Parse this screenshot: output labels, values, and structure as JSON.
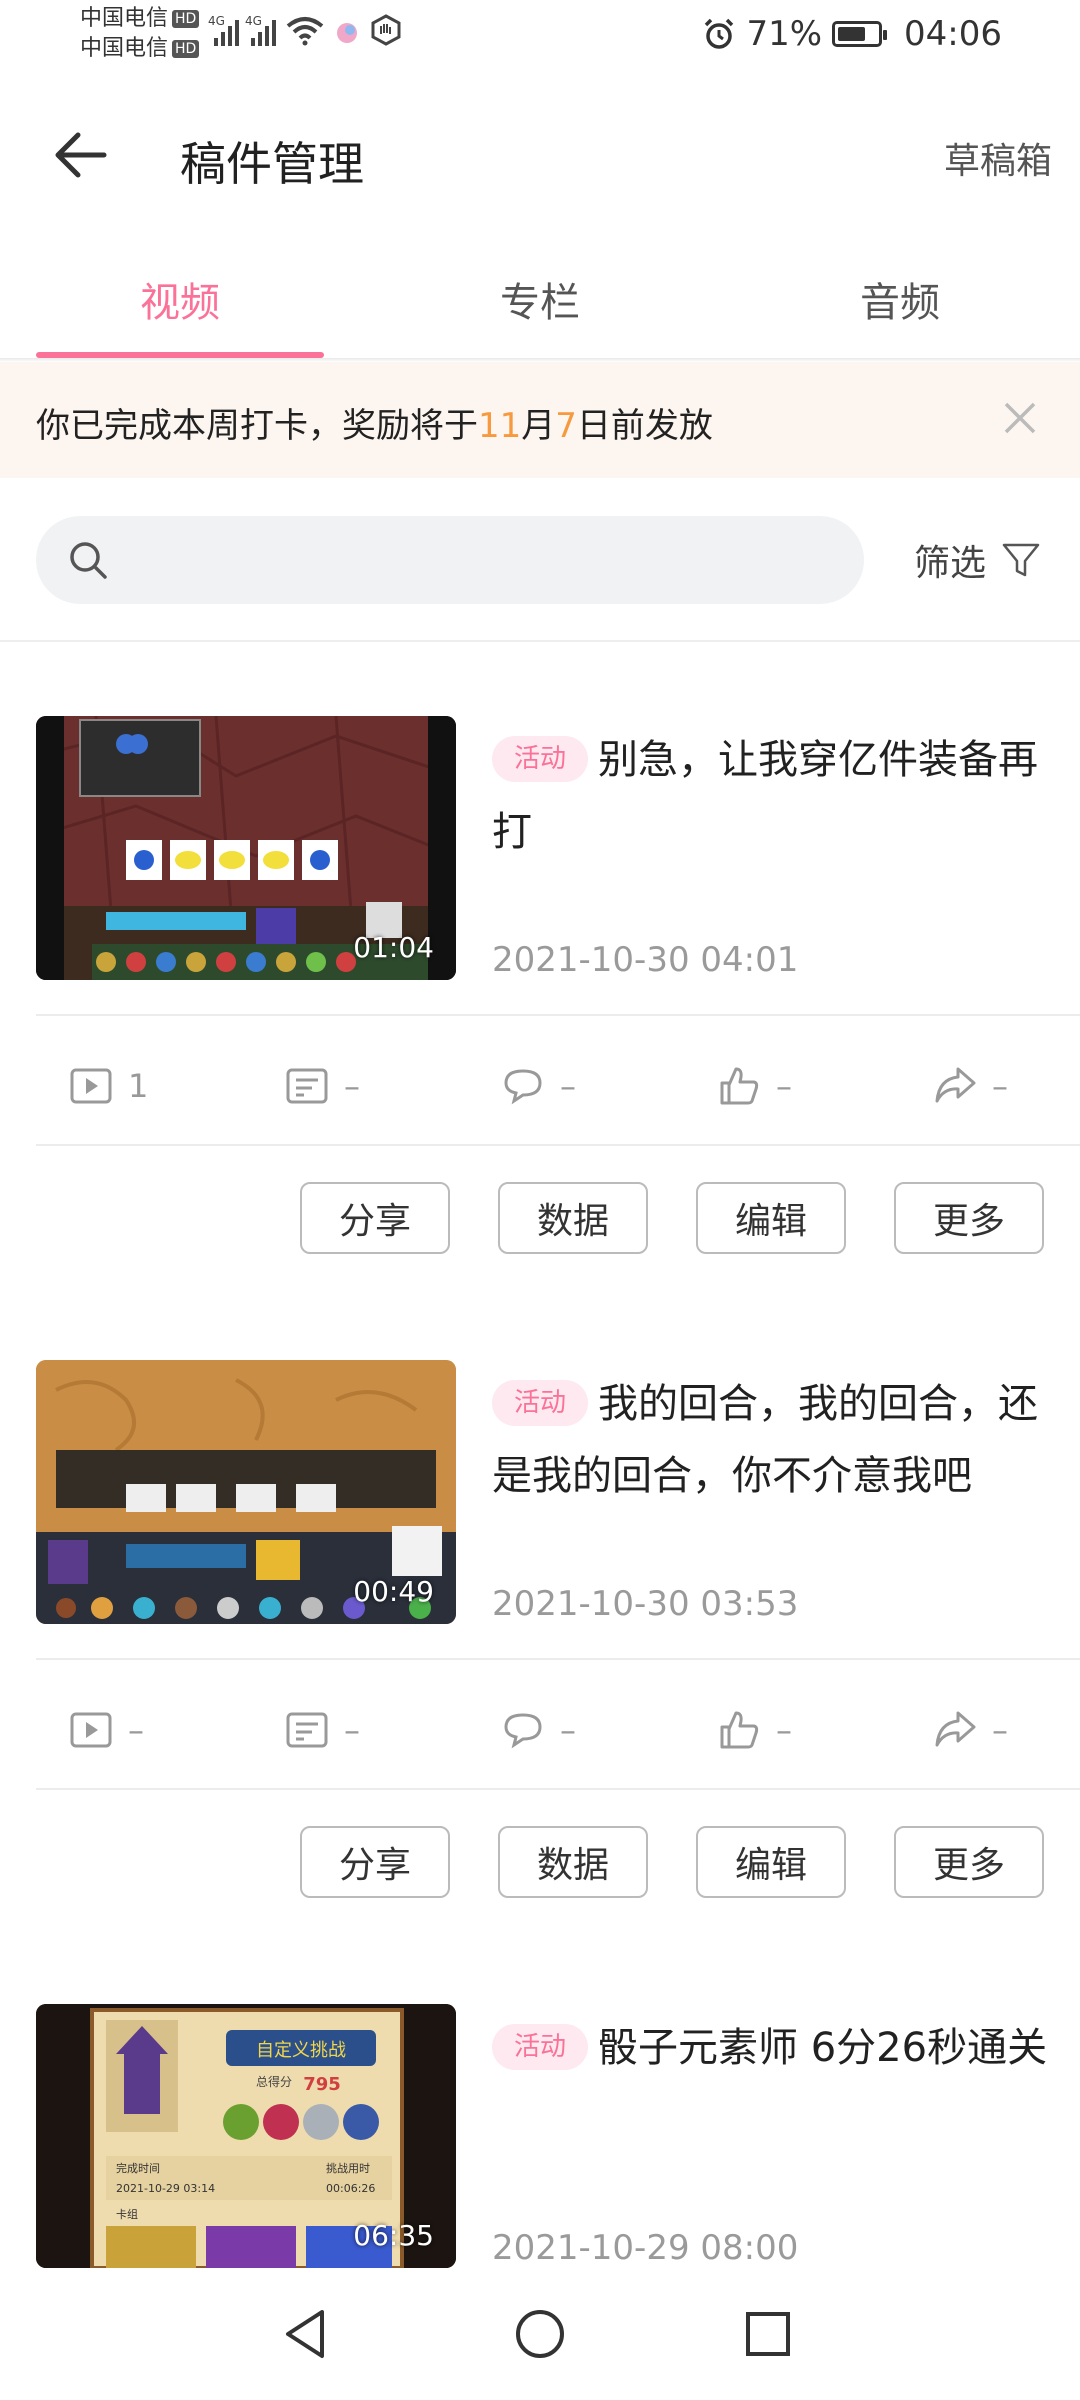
{
  "statusbar": {
    "carrier1": "中国电信",
    "carrier2": "中国电信",
    "hd": "HD",
    "net1": "4G",
    "net2": "4G",
    "battery_pct": "71%",
    "battery_level": 0.71,
    "time": "04:06"
  },
  "header": {
    "title": "稿件管理",
    "drafts": "草稿箱"
  },
  "tabs": [
    {
      "label": "视频",
      "active": true
    },
    {
      "label": "专栏",
      "active": false
    },
    {
      "label": "音频",
      "active": false
    }
  ],
  "notice": {
    "text_a": "你已完成本周打卡，奖励将于",
    "month": "11",
    "text_b": "月",
    "day": "7",
    "text_c": "日前发放"
  },
  "search": {
    "placeholder": "",
    "value": "",
    "filter_label": "筛选"
  },
  "videos": [
    {
      "badge": "活动",
      "title": "别急，让我穿亿件装备再打",
      "duration": "01:04",
      "date": "2021-10-30 04:01",
      "stats": {
        "plays": "1",
        "danmaku": "–",
        "comments": "–",
        "likes": "–",
        "shares": "–"
      }
    },
    {
      "badge": "活动",
      "title": "我的回合，我的回合，还是我的回合，你不介意我吧",
      "duration": "00:49",
      "date": "2021-10-30 03:53",
      "stats": {
        "plays": "–",
        "danmaku": "–",
        "comments": "–",
        "likes": "–",
        "shares": "–"
      }
    },
    {
      "badge": "活动",
      "title": "骰子元素师 6分26秒通关",
      "duration": "06:35",
      "date": "2021-10-29 08:00",
      "stats": {
        "plays": "–",
        "danmaku": "–",
        "comments": "–",
        "likes": "–",
        "shares": "–"
      }
    }
  ],
  "actions": {
    "share": "分享",
    "data": "数据",
    "edit": "编辑",
    "more": "更多"
  },
  "thumb_texts": {
    "v3_title": "自定义挑战",
    "v3_score_label": "总得分",
    "v3_score": "795",
    "v3_done": "完成时间",
    "v3_done_val": "2021-10-29 03:14",
    "v3_challenge": "挑战用时",
    "v3_challenge_val": "00:06:26",
    "v3_deck": "卡组"
  },
  "colors": {
    "accent": "#fb7299",
    "highlight": "#f6993f",
    "notice_bg": "#fdf6f0"
  }
}
